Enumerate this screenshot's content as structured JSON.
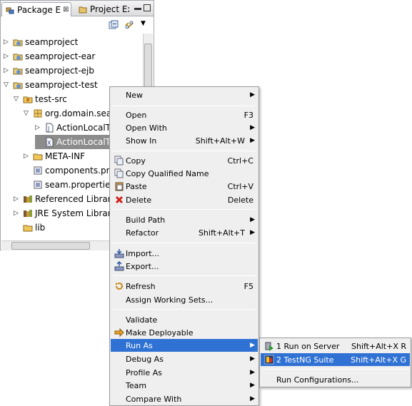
{
  "package_explorer": {
    "tabs": [
      {
        "label": "Package E",
        "close": "⊠"
      },
      {
        "label": "Project Ex"
      }
    ],
    "tree": [
      {
        "label": "seamproject"
      },
      {
        "label": "seamproject-ear"
      },
      {
        "label": "seamproject-ejb"
      },
      {
        "label": "seamproject-test"
      },
      {
        "label": "test-src"
      },
      {
        "label": "org.domain.seam"
      },
      {
        "label": "ActionLocalTest"
      },
      {
        "label": "ActionLocalTest"
      },
      {
        "label": "META-INF"
      },
      {
        "label": "components.prop"
      },
      {
        "label": "seam.properties"
      },
      {
        "label": "Referenced Libraries"
      },
      {
        "label": "JRE System Library [j"
      },
      {
        "label": "lib"
      }
    ]
  },
  "context_menu": {
    "items": [
      {
        "label": "New",
        "accel": "",
        "submenu": true
      },
      {
        "label": "Open",
        "accel": "F3"
      },
      {
        "label": "Open With",
        "accel": "",
        "submenu": true
      },
      {
        "label": "Show In",
        "accel": "Shift+Alt+W",
        "submenu": true
      },
      {
        "label": "Copy",
        "accel": "Ctrl+C",
        "icon": "copy-icon"
      },
      {
        "label": "Copy Qualified Name",
        "accel": "",
        "icon": "copy-qualified-icon"
      },
      {
        "label": "Paste",
        "accel": "Ctrl+V",
        "icon": "paste-icon"
      },
      {
        "label": "Delete",
        "accel": "Delete",
        "icon": "delete-icon"
      },
      {
        "label": "Build Path",
        "accel": "",
        "submenu": true
      },
      {
        "label": "Refactor",
        "accel": "Shift+Alt+T",
        "submenu": true
      },
      {
        "label": "Import...",
        "accel": "",
        "icon": "import-icon"
      },
      {
        "label": "Export...",
        "accel": "",
        "icon": "export-icon"
      },
      {
        "label": "Refresh",
        "accel": "F5",
        "icon": "refresh-icon"
      },
      {
        "label": "Assign Working Sets...",
        "accel": ""
      },
      {
        "label": "Validate",
        "accel": ""
      },
      {
        "label": "Make Deployable",
        "accel": "",
        "icon": "deploy-icon"
      },
      {
        "label": "Run As",
        "accel": "",
        "submenu": true,
        "highlighted": true
      },
      {
        "label": "Debug As",
        "accel": "",
        "submenu": true
      },
      {
        "label": "Profile As",
        "accel": "",
        "submenu": true
      },
      {
        "label": "Team",
        "accel": "",
        "submenu": true
      },
      {
        "label": "Compare With",
        "accel": "",
        "submenu": true
      }
    ]
  },
  "run_as_submenu": {
    "items": [
      {
        "label": "1 Run on Server",
        "accel": "Shift+Alt+X R"
      },
      {
        "label": "2 TestNG Suite",
        "accel": "Shift+Alt+X G",
        "highlighted": true
      },
      {
        "label": "Run Configurations...",
        "accel": ""
      }
    ]
  },
  "colors": {
    "selection": "#3072d4",
    "tree_selection": "#8c8c8c",
    "menu_bg": "#efefef"
  }
}
